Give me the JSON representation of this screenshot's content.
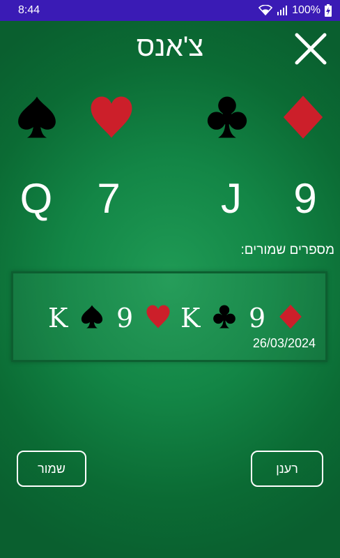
{
  "status_bar": {
    "time": "8:44",
    "battery": "100%"
  },
  "header": {
    "title": "צ'אנס",
    "close_icon": "close-icon"
  },
  "draw": {
    "cards": [
      {
        "rank": "Q",
        "suit": "spade",
        "color": "#000000"
      },
      {
        "rank": "7",
        "suit": "heart",
        "color": "#cc1f2a"
      },
      {
        "rank": "J",
        "suit": "club",
        "color": "#000000"
      },
      {
        "rank": "9",
        "suit": "diamond",
        "color": "#cc1f2a"
      }
    ]
  },
  "saved": {
    "label": "מספרים שמורים:",
    "entries": [
      {
        "cards": [
          {
            "rank": "K",
            "suit": "spade"
          },
          {
            "rank": "9",
            "suit": "heart"
          },
          {
            "rank": "K",
            "suit": "club"
          },
          {
            "rank": "9",
            "suit": "diamond"
          }
        ],
        "date": "26/03/2024"
      }
    ]
  },
  "actions": {
    "save_label": "שמור",
    "refresh_label": "רענן"
  },
  "colors": {
    "status_bar": "#3a1bb5",
    "table_green": "#138646",
    "red_suit": "#cc1f2a",
    "black_suit": "#000000"
  }
}
